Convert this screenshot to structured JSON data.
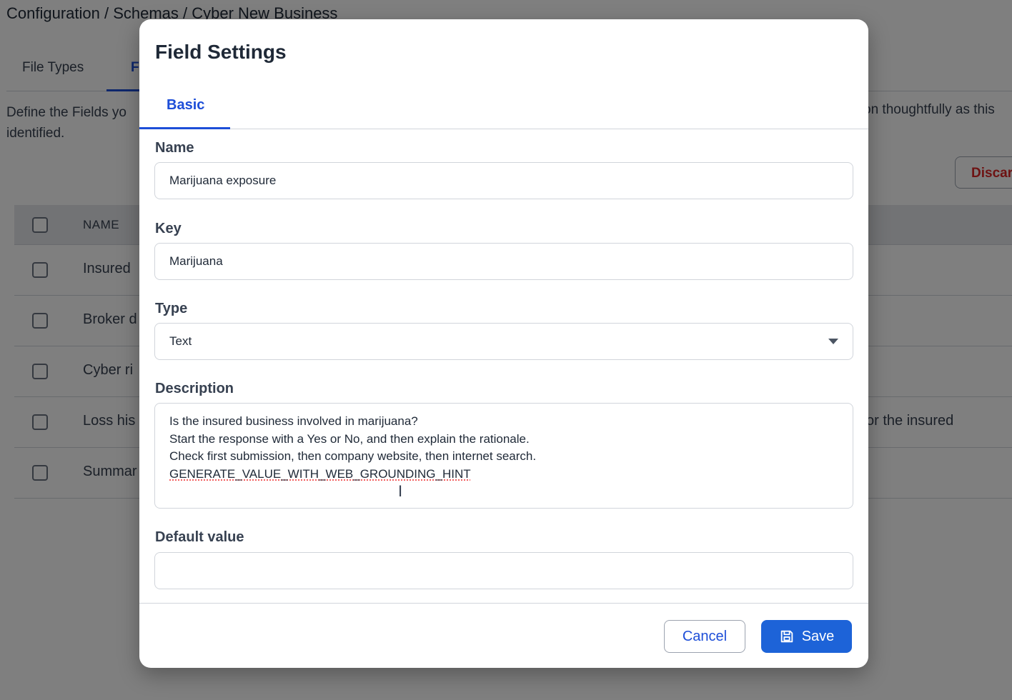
{
  "background": {
    "breadcrumb": "Configuration / Schemas / Cyber New Business",
    "tabs": [
      {
        "label": "File Types"
      },
      {
        "label": "F"
      }
    ],
    "description_left": "Define the Fields yo",
    "description_left_line2": "identified.",
    "description_right": "on thoughtfully as this",
    "discard_label": "Discar",
    "table": {
      "header_name": "NAME",
      "rows": [
        {
          "name": "Insured",
          "right": ""
        },
        {
          "name": "Broker d",
          "right": ""
        },
        {
          "name": "Cyber ri",
          "right": ""
        },
        {
          "name": "Loss his",
          "right": "or the insured"
        },
        {
          "name": "Summar",
          "right": ""
        }
      ]
    }
  },
  "modal": {
    "title": "Field Settings",
    "tabs": [
      {
        "label": "Basic"
      }
    ],
    "fields": {
      "name": {
        "label": "Name",
        "value": "Marijuana exposure"
      },
      "key": {
        "label": "Key",
        "value": "Marijuana"
      },
      "type": {
        "label": "Type",
        "value": "Text"
      },
      "description": {
        "label": "Description",
        "lines": [
          "Is the insured business involved in marijuana?",
          "Start the response with a Yes or No, and then explain the rationale.",
          "Check first submission, then company website, then internet search.",
          "GENERATE_VALUE_WITH_WEB_GROUNDING_HINT"
        ]
      },
      "default_value": {
        "label": "Default value",
        "value": ""
      }
    },
    "footer": {
      "cancel_label": "Cancel",
      "save_label": "Save"
    }
  },
  "colors": {
    "accent": "#1d4ed8",
    "save_button": "#1d63d8",
    "danger": "#dc2626"
  }
}
